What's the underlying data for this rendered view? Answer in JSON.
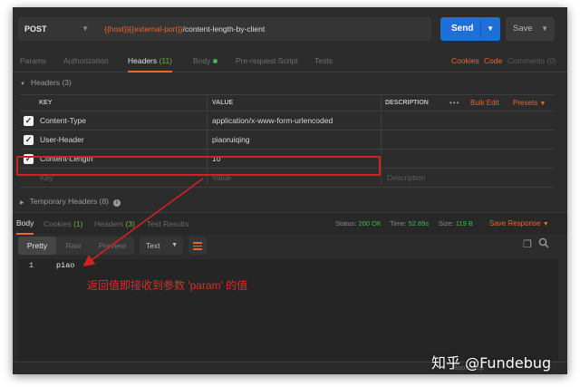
{
  "request": {
    "method": "POST",
    "url_var": "{{host}}{{external-port}}",
    "url_path": "/content-length-by-client",
    "send_label": "Send",
    "save_label": "Save"
  },
  "request_tabs": [
    {
      "label": "Params",
      "count": ""
    },
    {
      "label": "Authorization",
      "count": ""
    },
    {
      "label": "Headers",
      "count": "(11)"
    },
    {
      "label": "Body",
      "count": ""
    },
    {
      "label": "Pre-request Script",
      "count": ""
    },
    {
      "label": "Tests",
      "count": ""
    }
  ],
  "request_links": {
    "cookies": "Cookies",
    "code": "Code",
    "comments": "Comments (0)"
  },
  "headers_section": {
    "title": "Headers (3)",
    "columns": {
      "key": "KEY",
      "value": "VALUE",
      "description": "DESCRIPTION"
    },
    "actions": {
      "more": "•••",
      "bulk_edit": "Bulk Edit",
      "presets": "Presets"
    },
    "rows": [
      {
        "key": "Content-Type",
        "value": "application/x-www-form-urlencoded"
      },
      {
        "key": "User-Header",
        "value": "piaoruiqing"
      },
      {
        "key": "Content-Length",
        "value": "10"
      }
    ],
    "placeholders": {
      "key": "Key",
      "value": "Value",
      "description": "Description"
    }
  },
  "temporary_headers": "Temporary Headers (8)",
  "response_tabs": [
    {
      "label": "Body",
      "count": ""
    },
    {
      "label": "Cookies",
      "count": "(1)"
    },
    {
      "label": "Headers",
      "count": "(3)"
    },
    {
      "label": "Test Results",
      "count": ""
    }
  ],
  "response_status": {
    "status_label": "Status:",
    "status_value": "200 OK",
    "time_label": "Time:",
    "time_value": "52.69s",
    "size_label": "Size:",
    "size_value": "119 B",
    "save_response": "Save Response"
  },
  "view_modes": [
    "Pretty",
    "Raw",
    "Preview"
  ],
  "format": "Text",
  "body": {
    "line": "1",
    "content": "piao"
  },
  "annotation": "返回值即接收到参数 'param' 的值",
  "footer": {
    "bootcamp": "Bootcamp"
  },
  "watermark": "知乎 @Fundebug",
  "colors": {
    "accent": "#e8682b",
    "send": "#1f6fd8",
    "highlight": "#d42020",
    "ok": "#3fb950"
  }
}
